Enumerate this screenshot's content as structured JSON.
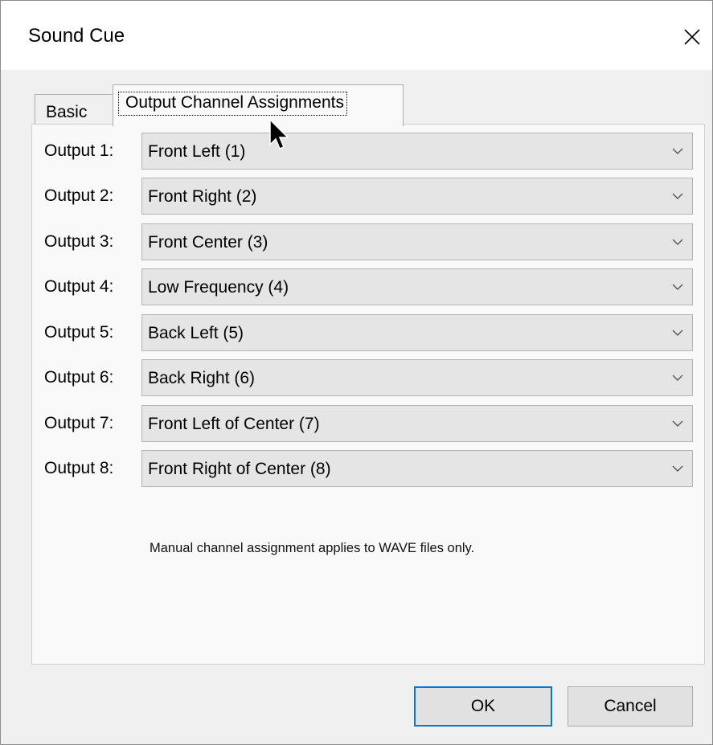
{
  "window": {
    "title": "Sound Cue"
  },
  "tabs": [
    {
      "label": "Basic",
      "active": false
    },
    {
      "label": "Output Channel Assignments",
      "active": true
    }
  ],
  "outputs": [
    {
      "label": "Output 1:",
      "value": "Front Left (1)"
    },
    {
      "label": "Output 2:",
      "value": "Front Right (2)"
    },
    {
      "label": "Output 3:",
      "value": "Front Center (3)"
    },
    {
      "label": "Output 4:",
      "value": "Low Frequency (4)"
    },
    {
      "label": "Output 5:",
      "value": "Back Left (5)"
    },
    {
      "label": "Output 6:",
      "value": "Back Right (6)"
    },
    {
      "label": "Output 7:",
      "value": "Front Left of Center (7)"
    },
    {
      "label": "Output 8:",
      "value": "Front Right of Center (8)"
    }
  ],
  "note": "Manual channel assignment applies to WAVE files only.",
  "buttons": {
    "ok": "OK",
    "cancel": "Cancel"
  },
  "icons": {
    "close": "close-icon",
    "dropdown": "chevron-down-icon",
    "cursor": "mouse-pointer-icon"
  },
  "colors": {
    "focus_border": "#0078d7",
    "combo_bg": "#e5e5e5",
    "panel_bg": "#f9f9f9",
    "dialog_bg": "#f0f0f0"
  }
}
